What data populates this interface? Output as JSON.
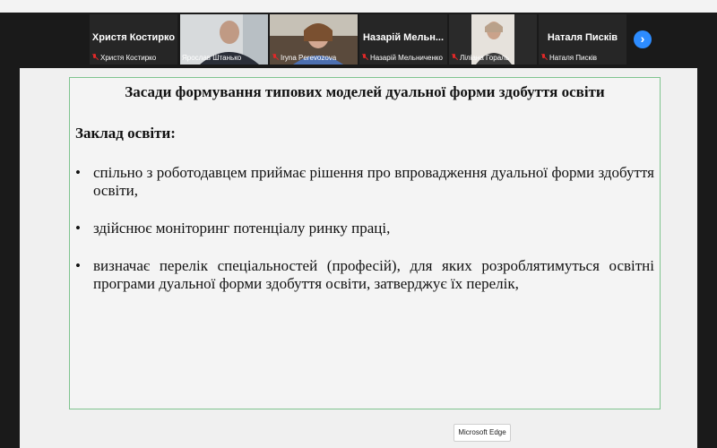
{
  "participants": [
    {
      "display_name": "Христя Костирко",
      "label": "Христя Костирко",
      "has_video": false,
      "muted": true
    },
    {
      "display_name": "",
      "label": "Ярослав Штанько",
      "has_video": true,
      "muted": false
    },
    {
      "display_name": "",
      "label": "Iryna Perevozova",
      "has_video": true,
      "muted": true
    },
    {
      "display_name": "Назарій  Мельн...",
      "label": "Назарій Мельниченко",
      "has_video": false,
      "muted": true
    },
    {
      "display_name": "",
      "label": "Ліліана Гораль",
      "has_video": true,
      "muted": true
    },
    {
      "display_name": "Наталя Писків",
      "label": "Наталя Писків",
      "has_video": false,
      "muted": true
    }
  ],
  "next_icon": "chevron-right-icon",
  "slide": {
    "title": "Засади формування типових моделей дуальної форми здобуття освіти",
    "heading": "Заклад освіти:",
    "bullet_symbol": "•",
    "bullets": [
      "спільно з роботодавцем приймає рішення про впровадження дуальної форми здобуття освіти,",
      "здійснює моніторинг потенціалу ринку праці,",
      "визначає перелік спеціальностей (професій), для яких розроблятимуться освітні програми дуальної форми здобуття освіти, затверджує їх перелік,"
    ]
  },
  "tooltip": {
    "text": "Microsoft Edge"
  },
  "colors": {
    "accent": "#2d8cff",
    "mute_red": "#e02828",
    "slide_border": "#7fc48f"
  }
}
